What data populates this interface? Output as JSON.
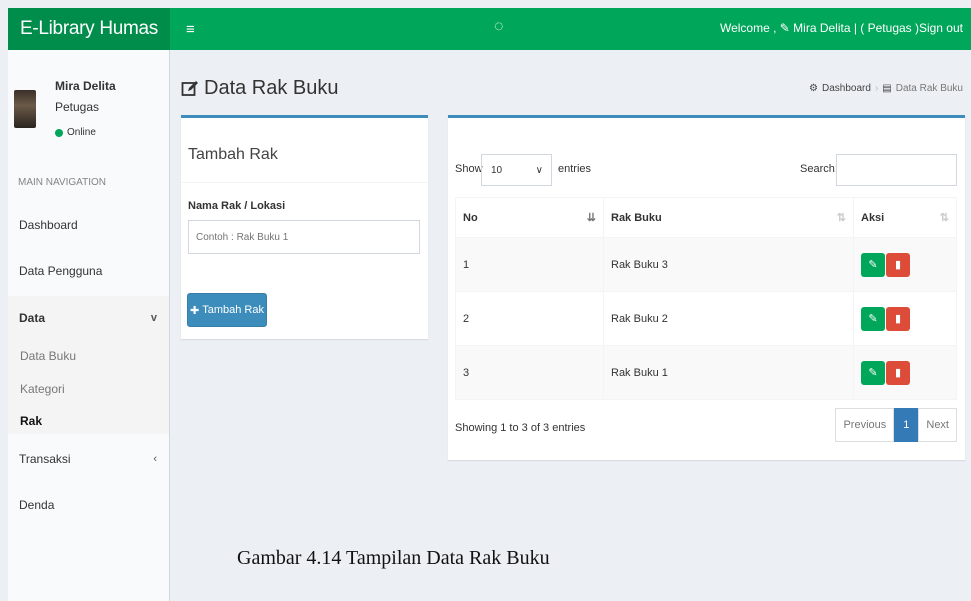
{
  "header": {
    "logo": "E-Library Humas",
    "menu_icon": "≡",
    "loader_icon": "◌",
    "welcome": "Welcome , ✎ Mira Delita | ( Petugas )",
    "signout": "Sign out",
    "brand_color": "#00a65a"
  },
  "user": {
    "name": "Mira Delita",
    "role": "Petugas",
    "status": "Online"
  },
  "sidebar": {
    "header": "MAIN NAVIGATION",
    "items": [
      {
        "label": "Dashboard"
      },
      {
        "label": "Data Pengguna"
      },
      {
        "label": "Data",
        "caret": "v"
      },
      {
        "label": "Transaksi",
        "caret": "‹"
      },
      {
        "label": "Denda"
      }
    ],
    "submenu": [
      {
        "label": "Data Buku"
      },
      {
        "label": "Kategori"
      },
      {
        "label": "Rak",
        "active": true
      }
    ]
  },
  "page": {
    "title": "Data Rak Buku",
    "breadcrumb": {
      "home": "Dashboard",
      "current": "Data Rak Buku"
    }
  },
  "form": {
    "title": "Tambah Rak",
    "field_label": "Nama Rak / Lokasi",
    "field_placeholder": "Contoh : Rak Buku 1",
    "submit_label": "Tambah Rak"
  },
  "table": {
    "show_label": "Show",
    "length_value": "10",
    "entries_label": "entries",
    "search_label": "Search:",
    "columns": [
      "No",
      "Rak Buku",
      "Aksi"
    ],
    "rows": [
      {
        "no": "1",
        "rak": "Rak Buku 3"
      },
      {
        "no": "2",
        "rak": "Rak Buku 2"
      },
      {
        "no": "3",
        "rak": "Rak Buku 1"
      }
    ],
    "info": "Showing 1 to 3 of 3 entries",
    "pager": {
      "prev": "Previous",
      "current": "1",
      "next": "Next"
    }
  },
  "caption": "Gambar 4.14  Tampilan Data Rak Buku"
}
